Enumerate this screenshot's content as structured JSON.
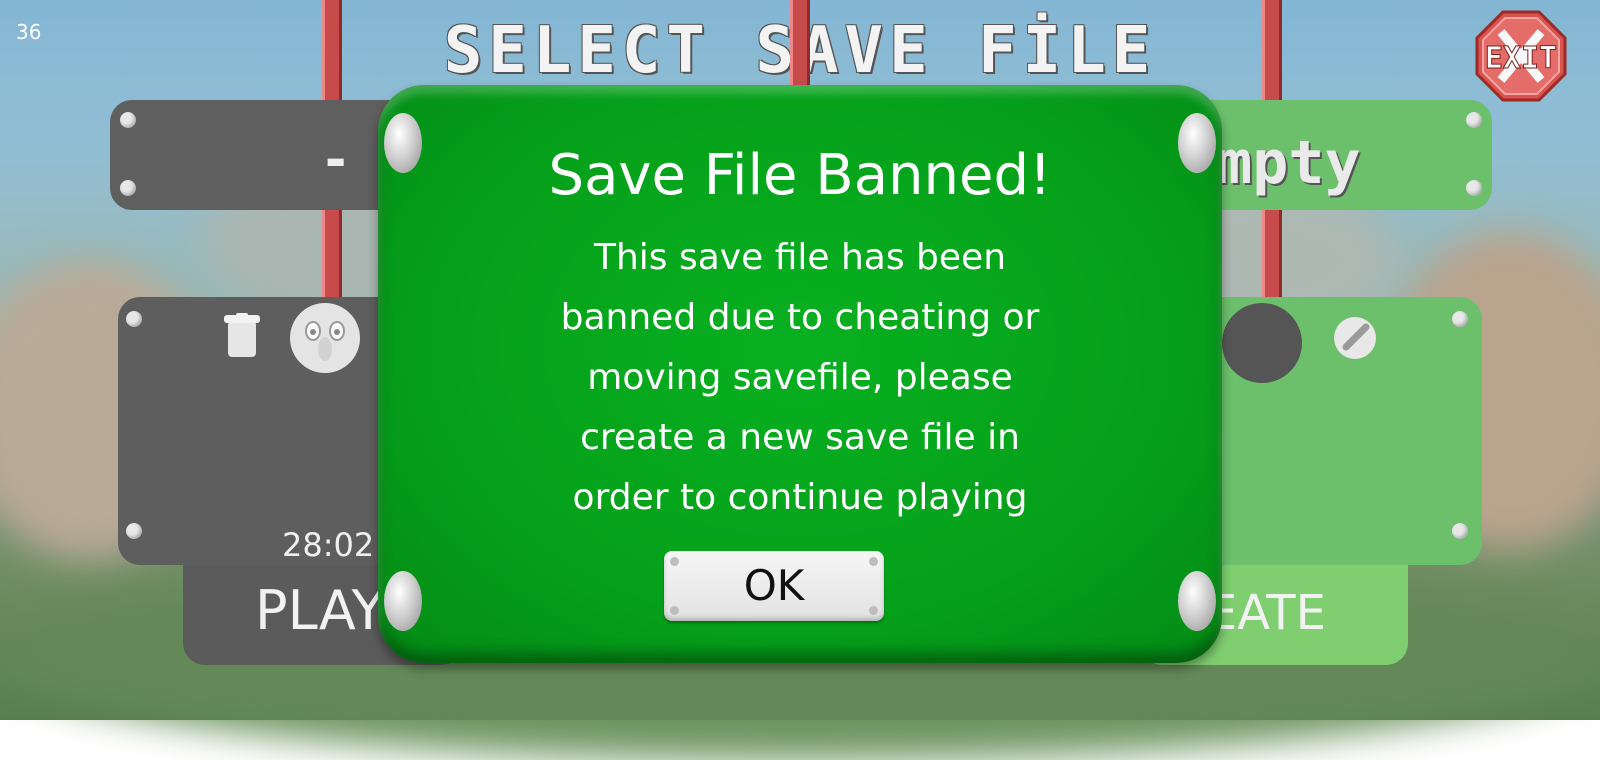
{
  "hud": {
    "fps": "36"
  },
  "screen": {
    "title": "SELECT SAVE FİLE",
    "exit_label": "EXIT"
  },
  "slots": {
    "slot1_top_label": "-",
    "slot1_time": "28:02",
    "slot1_play": "PLAY",
    "slot3_top_label": "Empty",
    "slot3_create": "CREATE"
  },
  "dialog": {
    "title": "Save File Banned!",
    "body_lines": [
      "This save file has been",
      "banned due to cheating or",
      "moving savefile, please",
      "create a new save file in",
      "order to continue playing"
    ],
    "ok_label": "OK"
  },
  "colors": {
    "dialog_green": "#05a01a",
    "slot_gray": "#5e5e5e",
    "slot_green": "#6cc06c",
    "rope_red": "#c84b4b",
    "exit_red": "#d9534f"
  }
}
